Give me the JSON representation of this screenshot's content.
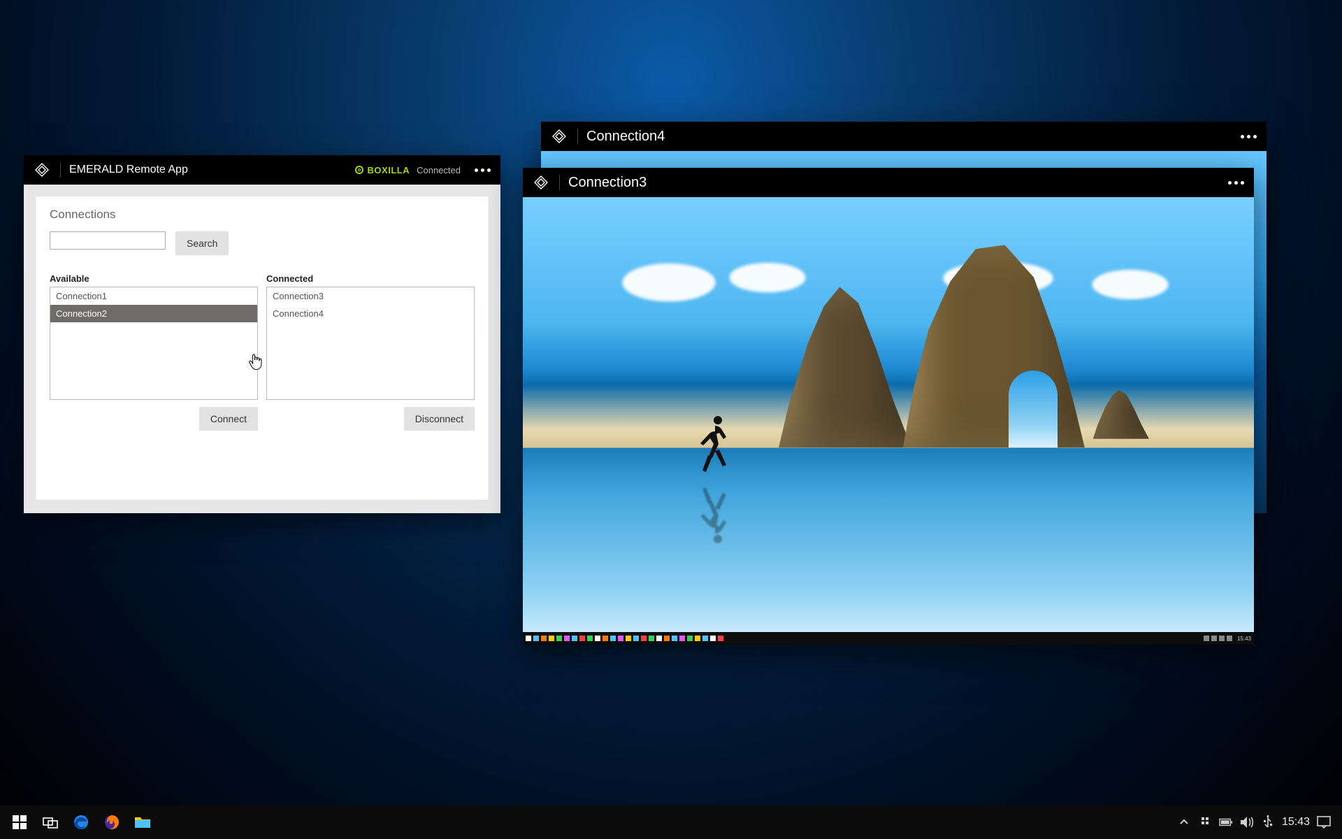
{
  "emerald": {
    "title": "EMERALD Remote App",
    "status_brand": "BOXILLA",
    "status_text": "Connected",
    "panel_title": "Connections",
    "search_label": "Search",
    "available_label": "Available",
    "connected_label": "Connected",
    "available": [
      "Connection1",
      "Connection2"
    ],
    "available_selected_index": 1,
    "connected": [
      "Connection3",
      "Connection4"
    ],
    "connect_label": "Connect",
    "disconnect_label": "Disconnect"
  },
  "remote_back": {
    "title": "Connection4"
  },
  "remote_front": {
    "title": "Connection3",
    "inner_taskbar_time": "15:43"
  },
  "host_taskbar": {
    "clock": "15:43"
  }
}
